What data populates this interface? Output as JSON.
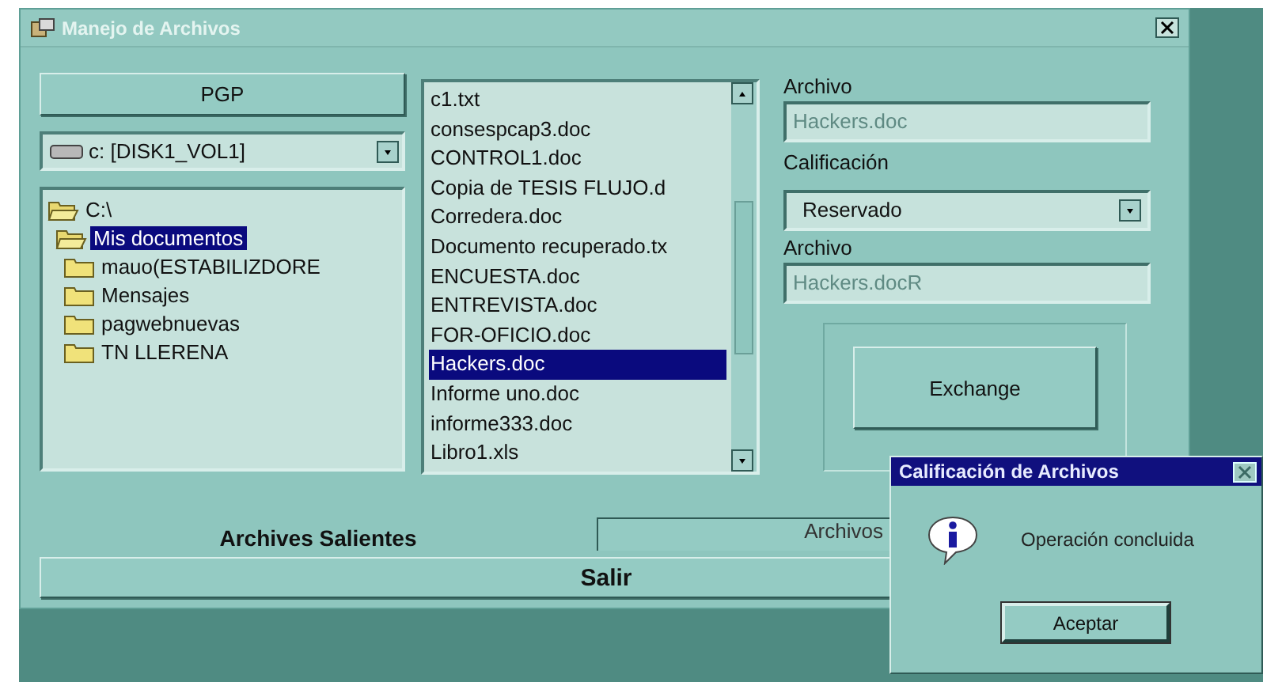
{
  "window": {
    "title": "Manejo de Archivos"
  },
  "pgp_button": {
    "label": "PGP"
  },
  "drive_select": {
    "value": "c: [DISK1_VOL1]"
  },
  "folder_tree": [
    {
      "label": "C:\\",
      "selected": false,
      "children": [
        {
          "label": "Mis documentos",
          "selected": true,
          "children": [
            {
              "label": "mauo(ESTABILIZDORE",
              "selected": false
            },
            {
              "label": "Mensajes",
              "selected": false
            },
            {
              "label": "pagwebnuevas",
              "selected": false
            },
            {
              "label": "TN LLERENA",
              "selected": false
            }
          ]
        }
      ]
    }
  ],
  "file_list": [
    {
      "name": "c1.txt",
      "selected": false
    },
    {
      "name": "consespcap3.doc",
      "selected": false
    },
    {
      "name": "CONTROL1.doc",
      "selected": false
    },
    {
      "name": "Copia de TESIS FLUJO.d",
      "selected": false
    },
    {
      "name": "Corredera.doc",
      "selected": false
    },
    {
      "name": "Documento recuperado.tx",
      "selected": false
    },
    {
      "name": "ENCUESTA.doc",
      "selected": false
    },
    {
      "name": "ENTREVISTA.doc",
      "selected": false
    },
    {
      "name": "FOR-OFICIO.doc",
      "selected": false
    },
    {
      "name": "Hackers.doc",
      "selected": true
    },
    {
      "name": "Informe uno.doc",
      "selected": false
    },
    {
      "name": "informe333.doc",
      "selected": false
    },
    {
      "name": "Libro1.xls",
      "selected": false
    }
  ],
  "form": [
    {
      "kind": "field",
      "label": "Archivo",
      "value": "Hackers.doc",
      "disabled": true
    },
    {
      "kind": "select",
      "label": "Calificación",
      "value": "Reservado"
    },
    {
      "kind": "field",
      "label": "Archivo",
      "value": "Hackers.docR",
      "disabled": true
    }
  ],
  "exchange_button": {
    "label": "Exchange"
  },
  "outgoing_label": "Archives Salientes",
  "incoming_tab": {
    "label": "Archivos"
  },
  "exit_button": {
    "label": "Salir"
  },
  "dialog": {
    "title": "Calificación de Archivos",
    "message": "Operación concluida",
    "button": "Aceptar"
  }
}
